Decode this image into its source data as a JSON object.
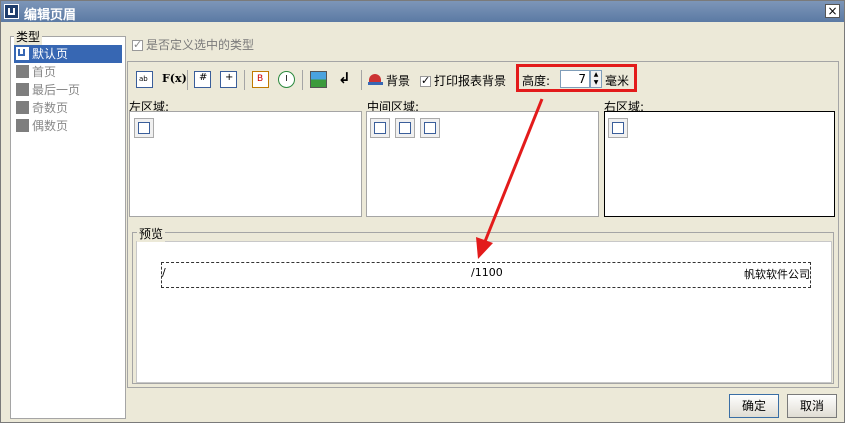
{
  "window": {
    "title": "编辑页眉",
    "close_label": "×"
  },
  "type_panel": {
    "label": "类型",
    "items": [
      {
        "label": "默认页",
        "selected": true
      },
      {
        "label": "首页",
        "selected": false
      },
      {
        "label": "最后一页",
        "selected": false
      },
      {
        "label": "奇数页",
        "selected": false
      },
      {
        "label": "偶数页",
        "selected": false
      }
    ]
  },
  "custom_type": {
    "label": "是否定义选中的类型",
    "checked": true
  },
  "toolbar": {
    "text_icon": "ab",
    "formula_label": "F(x)",
    "page_number_icon": "#",
    "total_pages_icon": "+",
    "date_icon": "B",
    "time_icon": "clock-icon",
    "image_icon": "image-icon",
    "newline_icon": "↲",
    "background_label": "背景",
    "print_bg_label": "打印报表背景",
    "print_bg_checked": true,
    "height_label": "高度:",
    "height_value": "7",
    "height_unit": "毫米"
  },
  "regions": {
    "left_label": "左区域:",
    "middle_label": "中间区域:",
    "right_label": "右区域:"
  },
  "preview": {
    "label": "预览",
    "left_text": "/",
    "middle_text": "/1100",
    "right_text": "帆软软件公司"
  },
  "buttons": {
    "ok_label": "确定",
    "cancel_label": "取消"
  },
  "colors": {
    "accent": "#e31b1b",
    "selection": "#3767b3"
  }
}
